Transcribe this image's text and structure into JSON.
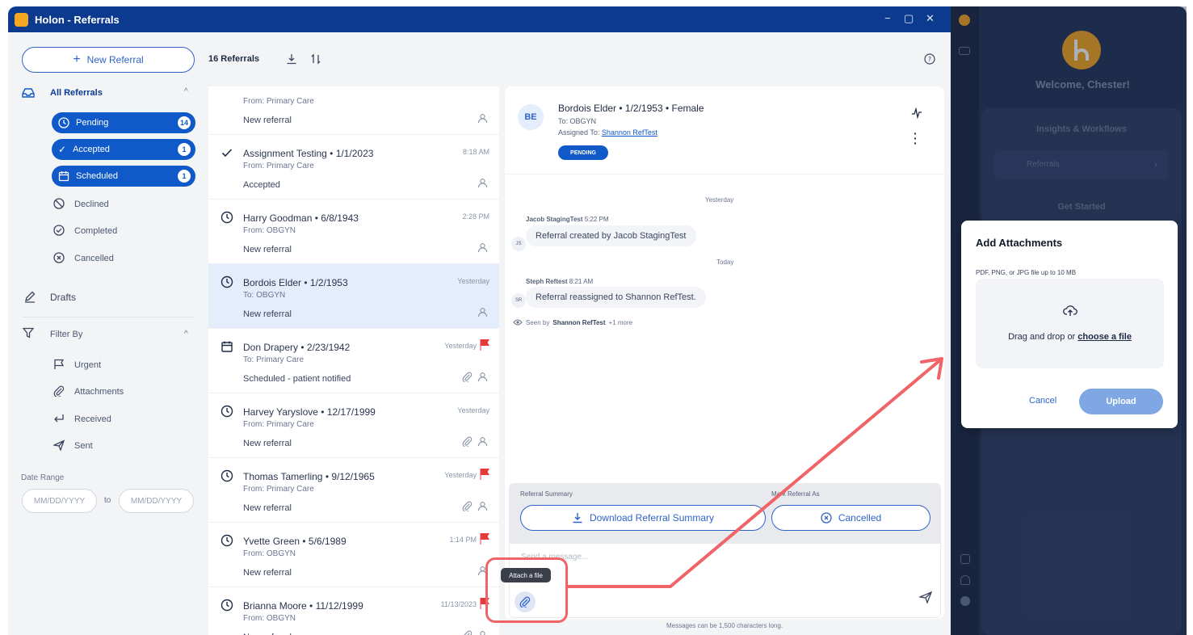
{
  "window": {
    "title": "Holon - Referrals",
    "controls": [
      "−",
      "▢",
      "✕"
    ]
  },
  "sidebar": {
    "new_referral": "New Referral",
    "all_referrals": "All Referrals",
    "status_items": [
      {
        "label": "Pending",
        "count": "14",
        "icon": "clock-icon"
      },
      {
        "label": "Accepted",
        "count": "1",
        "icon": "check-icon"
      },
      {
        "label": "Scheduled",
        "count": "1",
        "icon": "calendar-icon"
      }
    ],
    "other_items": [
      "Declined",
      "Completed",
      "Cancelled"
    ],
    "drafts": "Drafts",
    "filter_by": "Filter By",
    "filters": [
      "Urgent",
      "Attachments",
      "Received",
      "Sent"
    ],
    "date_range": "Date Range",
    "date_from_placeholder": "MM/DD/YYYY",
    "date_to_placeholder": "MM/DD/YYYY",
    "date_to_word": "to"
  },
  "list": {
    "count": "16 Referrals",
    "rows": [
      {
        "name": "",
        "from": "From: Primary Care",
        "status": "New referral",
        "time": "",
        "icon": "none",
        "flag": false,
        "attach": false
      },
      {
        "name": "Assignment Testing • 1/1/2023",
        "from": "From: Primary Care",
        "status": "Accepted",
        "time": "8:18 AM",
        "icon": "check",
        "flag": false,
        "attach": false
      },
      {
        "name": "Harry Goodman • 6/8/1943",
        "from": "From: OBGYN",
        "status": "New referral",
        "time": "2:28 PM",
        "icon": "clock",
        "flag": false,
        "attach": false
      },
      {
        "name": "Bordois Elder • 1/2/1953",
        "from": "To: OBGYN",
        "status": "New referral",
        "time": "Yesterday",
        "icon": "clock",
        "flag": false,
        "attach": false
      },
      {
        "name": "Don Drapery • 2/23/1942",
        "from": "To: Primary Care",
        "status": "Scheduled - patient notified",
        "time": "Yesterday",
        "icon": "calendar",
        "flag": true,
        "attach": true
      },
      {
        "name": "Harvey Yaryslove • 12/17/1999",
        "from": "From: Primary Care",
        "status": "New referral",
        "time": "Yesterday",
        "icon": "clock",
        "flag": false,
        "attach": true
      },
      {
        "name": "Thomas Tamerling • 9/12/1965",
        "from": "From: Primary Care",
        "status": "New referral",
        "time": "Yesterday",
        "icon": "clock",
        "flag": true,
        "attach": true
      },
      {
        "name": "Yvette Green • 5/6/1989",
        "from": "From: OBGYN",
        "status": "New referral",
        "time": "1:14 PM",
        "icon": "clock",
        "flag": true,
        "attach": false
      },
      {
        "name": "Brianna Moore • 11/12/1999",
        "from": "From: OBGYN",
        "status": "New referral",
        "time": "11/13/2023",
        "icon": "clock",
        "flag": true,
        "attach": true
      }
    ]
  },
  "detail": {
    "initials": "BE",
    "name": "Bordois Elder • 1/2/1953 • Female",
    "to": "To: OBGYN",
    "assigned_prefix": "Assigned To:",
    "assigned_to": "Shannon RefTest",
    "status": "PENDING",
    "day1": "Yesterday",
    "msg1_author": "Jacob StagingTest",
    "msg1_time": "5:22 PM",
    "msg1_initials": "JS",
    "msg1_text": "Referral created by  Jacob StagingTest",
    "day2": "Today",
    "msg2_author": "Steph Reftest",
    "msg2_time": "8:21 AM",
    "msg2_initials": "SR",
    "msg2_text": "Referral reassigned to Shannon RefTest.",
    "seen_prefix": "Seen by",
    "seen_by": "Shannon RefTest",
    "seen_more": "+1 more",
    "summary_label": "Referral Summary",
    "mark_label": "Mark Referral As",
    "download_btn": "Download Referral Summary",
    "cancelled_btn": "Cancelled",
    "message_placeholder": "Send a message...",
    "tooltip": "Attach a file",
    "char_limit": "Messages can be 1,500 characters long."
  },
  "modal": {
    "title": "Add Attachments",
    "hint": "PDF, PNG, or JPG file up to 10 MB",
    "drag_text": "Drag and drop or",
    "choose": "choose a file",
    "cancel": "Cancel",
    "upload": "Upload"
  },
  "dashboard": {
    "welcome": "Welcome, Chester!",
    "insights": "Insights & Workflows",
    "referrals": "Referrals",
    "get_started": "Get Started"
  },
  "colors": {
    "brand": "#0b3a8f",
    "accent": "#0f59c9",
    "flag": "#e5383b",
    "annotation": "#f06467"
  }
}
